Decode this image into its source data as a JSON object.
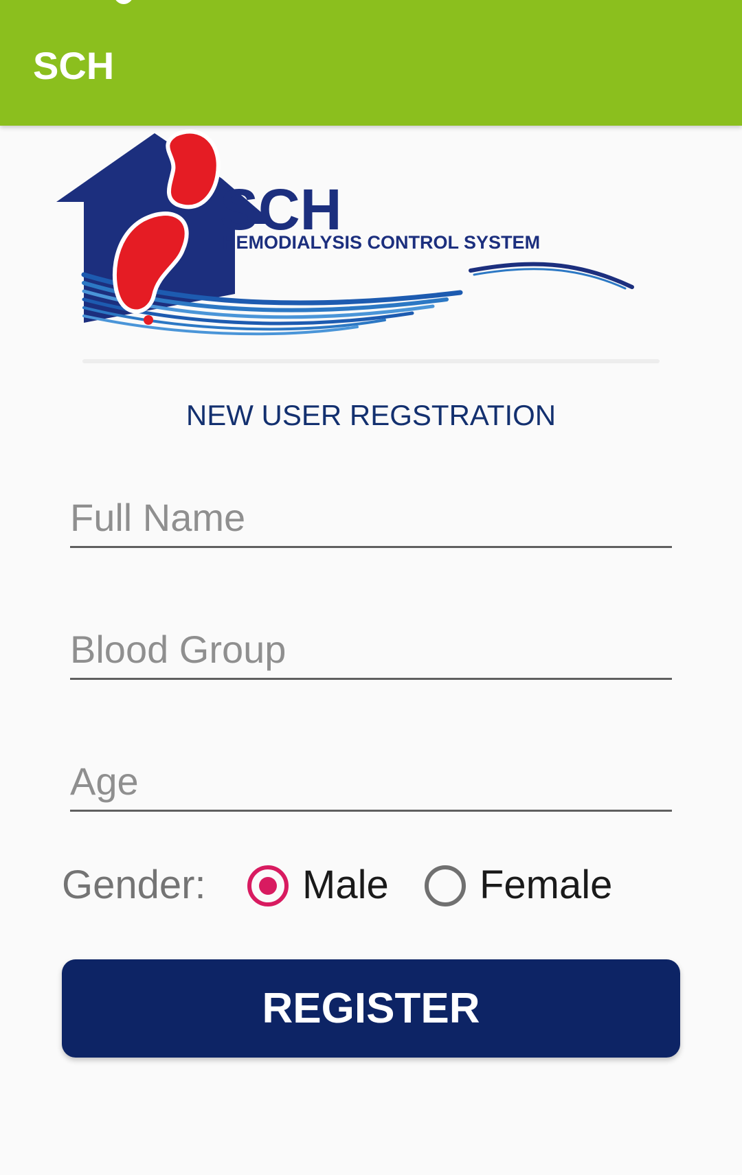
{
  "app_bar": {
    "title": "SCH"
  },
  "logo": {
    "brand": "SCH",
    "subtitle": "HEMODIALYSIS CONTROL SYSTEM"
  },
  "form": {
    "title": "NEW USER REGSTRATION",
    "full_name_placeholder": "Full Name",
    "blood_group_placeholder": "Blood Group",
    "age_placeholder": "Age",
    "gender_label": "Gender:",
    "gender_options": [
      {
        "label": "Male",
        "selected": true
      },
      {
        "label": "Female",
        "selected": false
      }
    ],
    "register_label": "REGISTER"
  },
  "colors": {
    "app_bar": "#8bbf1e",
    "button": "#0d2465",
    "radio_accent": "#d81b60",
    "title_text": "#13306f"
  }
}
